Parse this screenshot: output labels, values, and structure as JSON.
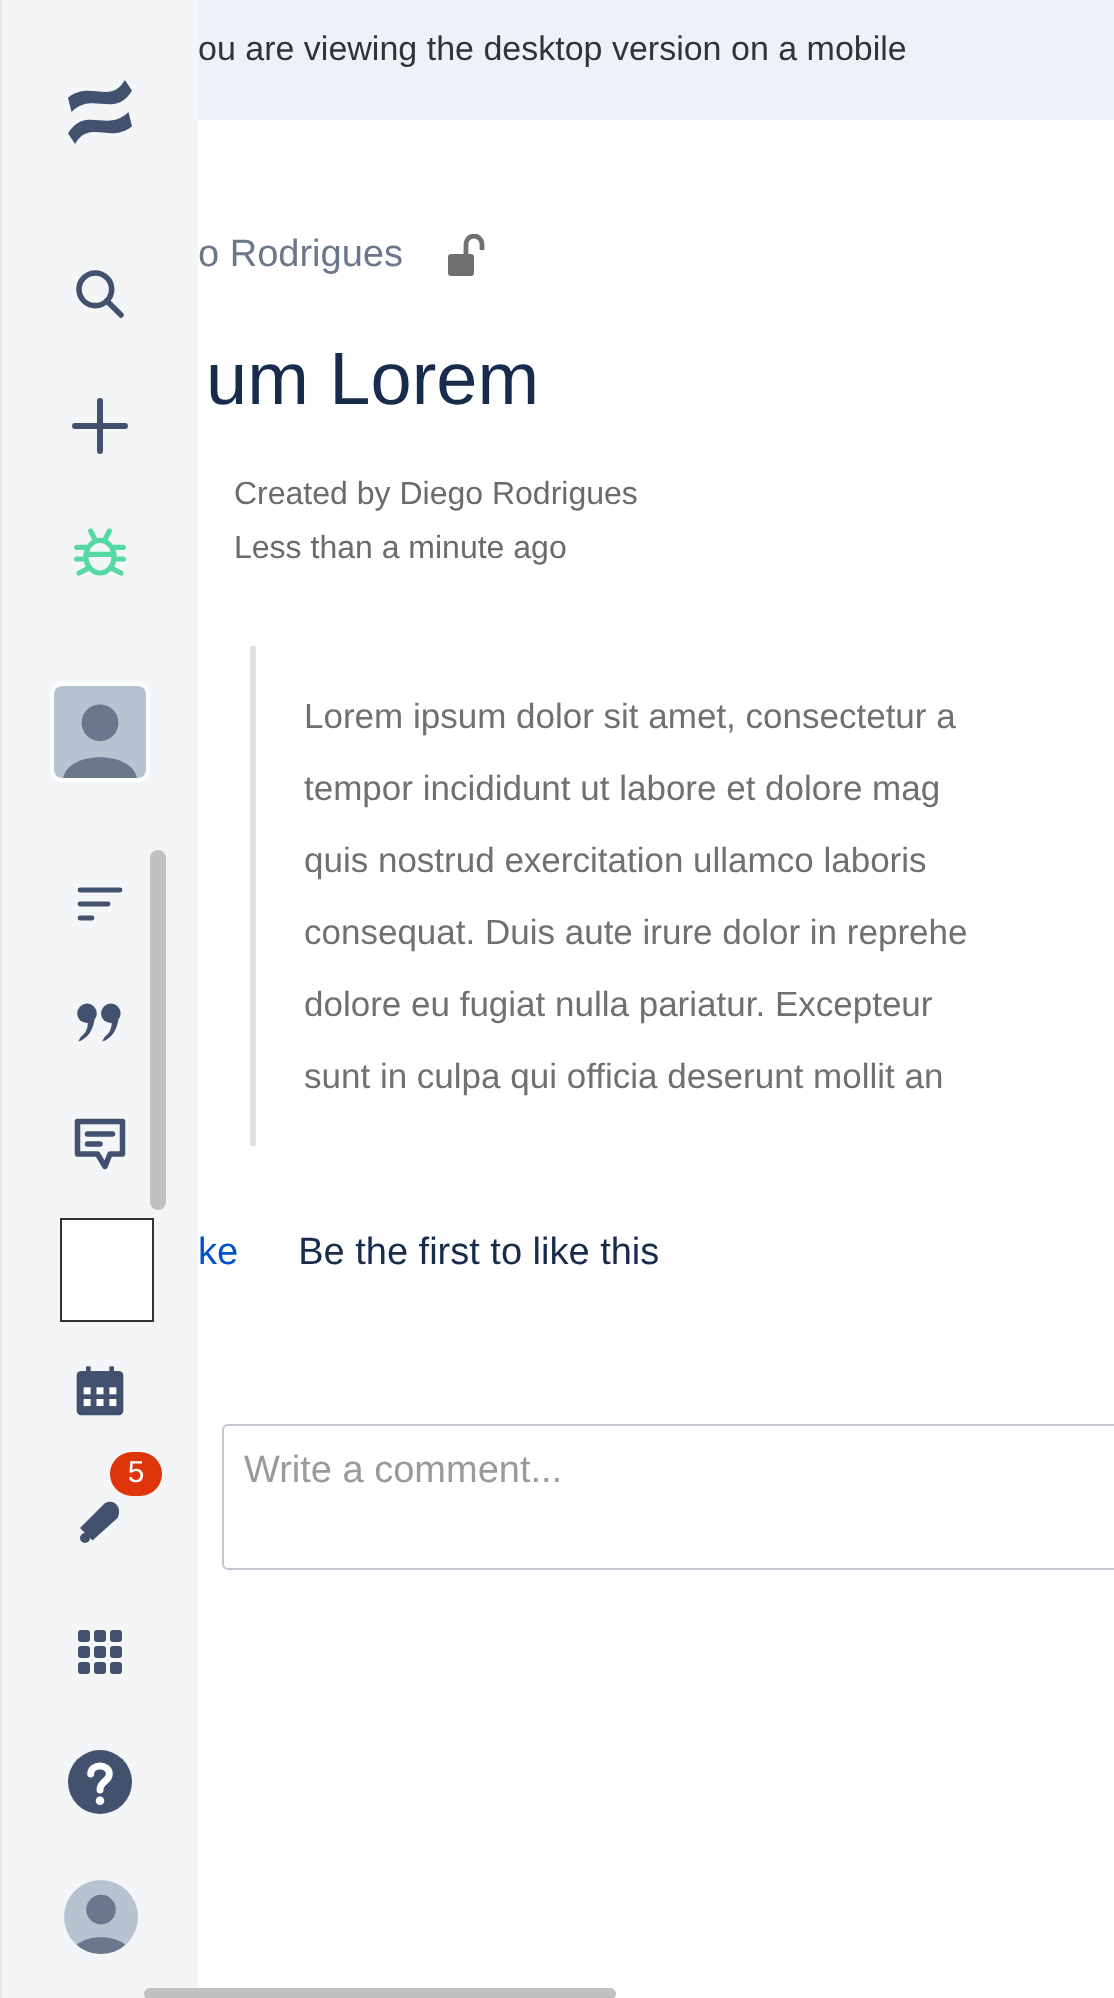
{
  "banner": {
    "text": "ou are viewing the desktop version on a mobile"
  },
  "breadcrumb": {
    "text": "o Rodrigues",
    "restricted": false
  },
  "page": {
    "title": "um Lorem",
    "created_by": "Created by Diego Rodrigues",
    "updated": "Less than a minute ago"
  },
  "quote_lines": [
    "Lorem ipsum dolor sit amet, consectetur a",
    "tempor incididunt ut labore et dolore mag",
    "quis nostrud exercitation ullamco laboris",
    "consequat. Duis aute irure dolor in reprehe",
    "dolore eu fugiat nulla pariatur. Excepteur",
    "sunt in culpa qui officia deserunt mollit an"
  ],
  "likes": {
    "link": "ke",
    "text": "Be the first to like this"
  },
  "comment": {
    "placeholder": "Write a comment..."
  },
  "sidebar": {
    "notification_count": "5"
  }
}
